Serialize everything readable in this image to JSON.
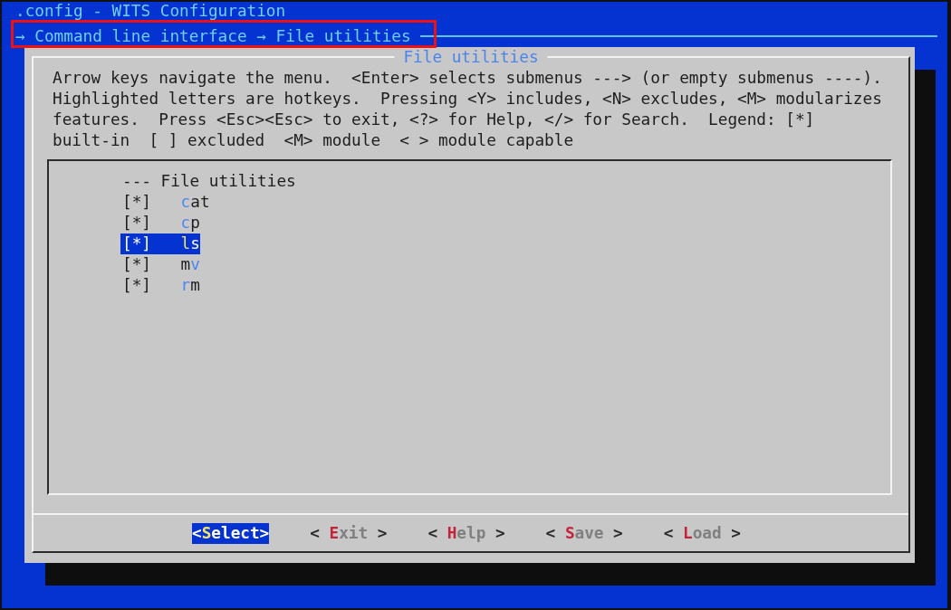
{
  "screen": {
    "title": ".config - WITS Configuration",
    "breadcrumb": {
      "text": "→ Command line interface → File utilities",
      "highlighted": true
    }
  },
  "dialog": {
    "title": "File utilities",
    "help_lines": [
      "Arrow keys navigate the menu.  <Enter> selects submenus ---> (or empty submenus ----).",
      "Highlighted letters are hotkeys.  Pressing <Y> includes, <N> excludes, <M> modularizes",
      "features.  Press <Esc><Esc> to exit, <?> for Help, </> for Search.  Legend: [*]",
      "built-in  [ ] excluded  <M> module  < > module capable"
    ],
    "menu": {
      "heading": "--- File utilities",
      "items": [
        {
          "marker": "[*]",
          "label": [
            {
              "text": "c",
              "hotkey": true
            },
            {
              "text": "at",
              "hotkey": false
            }
          ],
          "selected": false
        },
        {
          "marker": "[*]",
          "label": [
            {
              "text": "c",
              "hotkey": true
            },
            {
              "text": "p",
              "hotkey": false
            }
          ],
          "selected": false
        },
        {
          "marker": "[*]",
          "label": [
            {
              "text": "l",
              "hotkey": true
            },
            {
              "text": "s",
              "hotkey": false
            }
          ],
          "selected": true
        },
        {
          "marker": "[*]",
          "label": [
            {
              "text": "m",
              "hotkey": false
            },
            {
              "text": "v",
              "hotkey": true
            }
          ],
          "selected": false
        },
        {
          "marker": "[*]",
          "label": [
            {
              "text": "r",
              "hotkey": true
            },
            {
              "text": "m",
              "hotkey": false
            }
          ],
          "selected": false
        }
      ]
    },
    "buttons": [
      {
        "open": "<",
        "label": [
          {
            "text": "S",
            "hotkey": true
          },
          {
            "text": "elect",
            "hotkey": false
          }
        ],
        "close": ">",
        "selected": true
      },
      {
        "open": "<",
        "label": [
          {
            "text": "E",
            "hotkey": true
          },
          {
            "text": "xit",
            "hotkey": false
          }
        ],
        "close": ">",
        "selected": false
      },
      {
        "open": "<",
        "label": [
          {
            "text": "H",
            "hotkey": true
          },
          {
            "text": "elp",
            "hotkey": false
          }
        ],
        "close": ">",
        "selected": false
      },
      {
        "open": "<",
        "label": [
          {
            "text": "S",
            "hotkey": true
          },
          {
            "text": "ave",
            "hotkey": false
          }
        ],
        "close": ">",
        "selected": false
      },
      {
        "open": "<",
        "label": [
          {
            "text": "L",
            "hotkey": true
          },
          {
            "text": "oad",
            "hotkey": false
          }
        ],
        "close": ">",
        "selected": false
      }
    ]
  }
}
